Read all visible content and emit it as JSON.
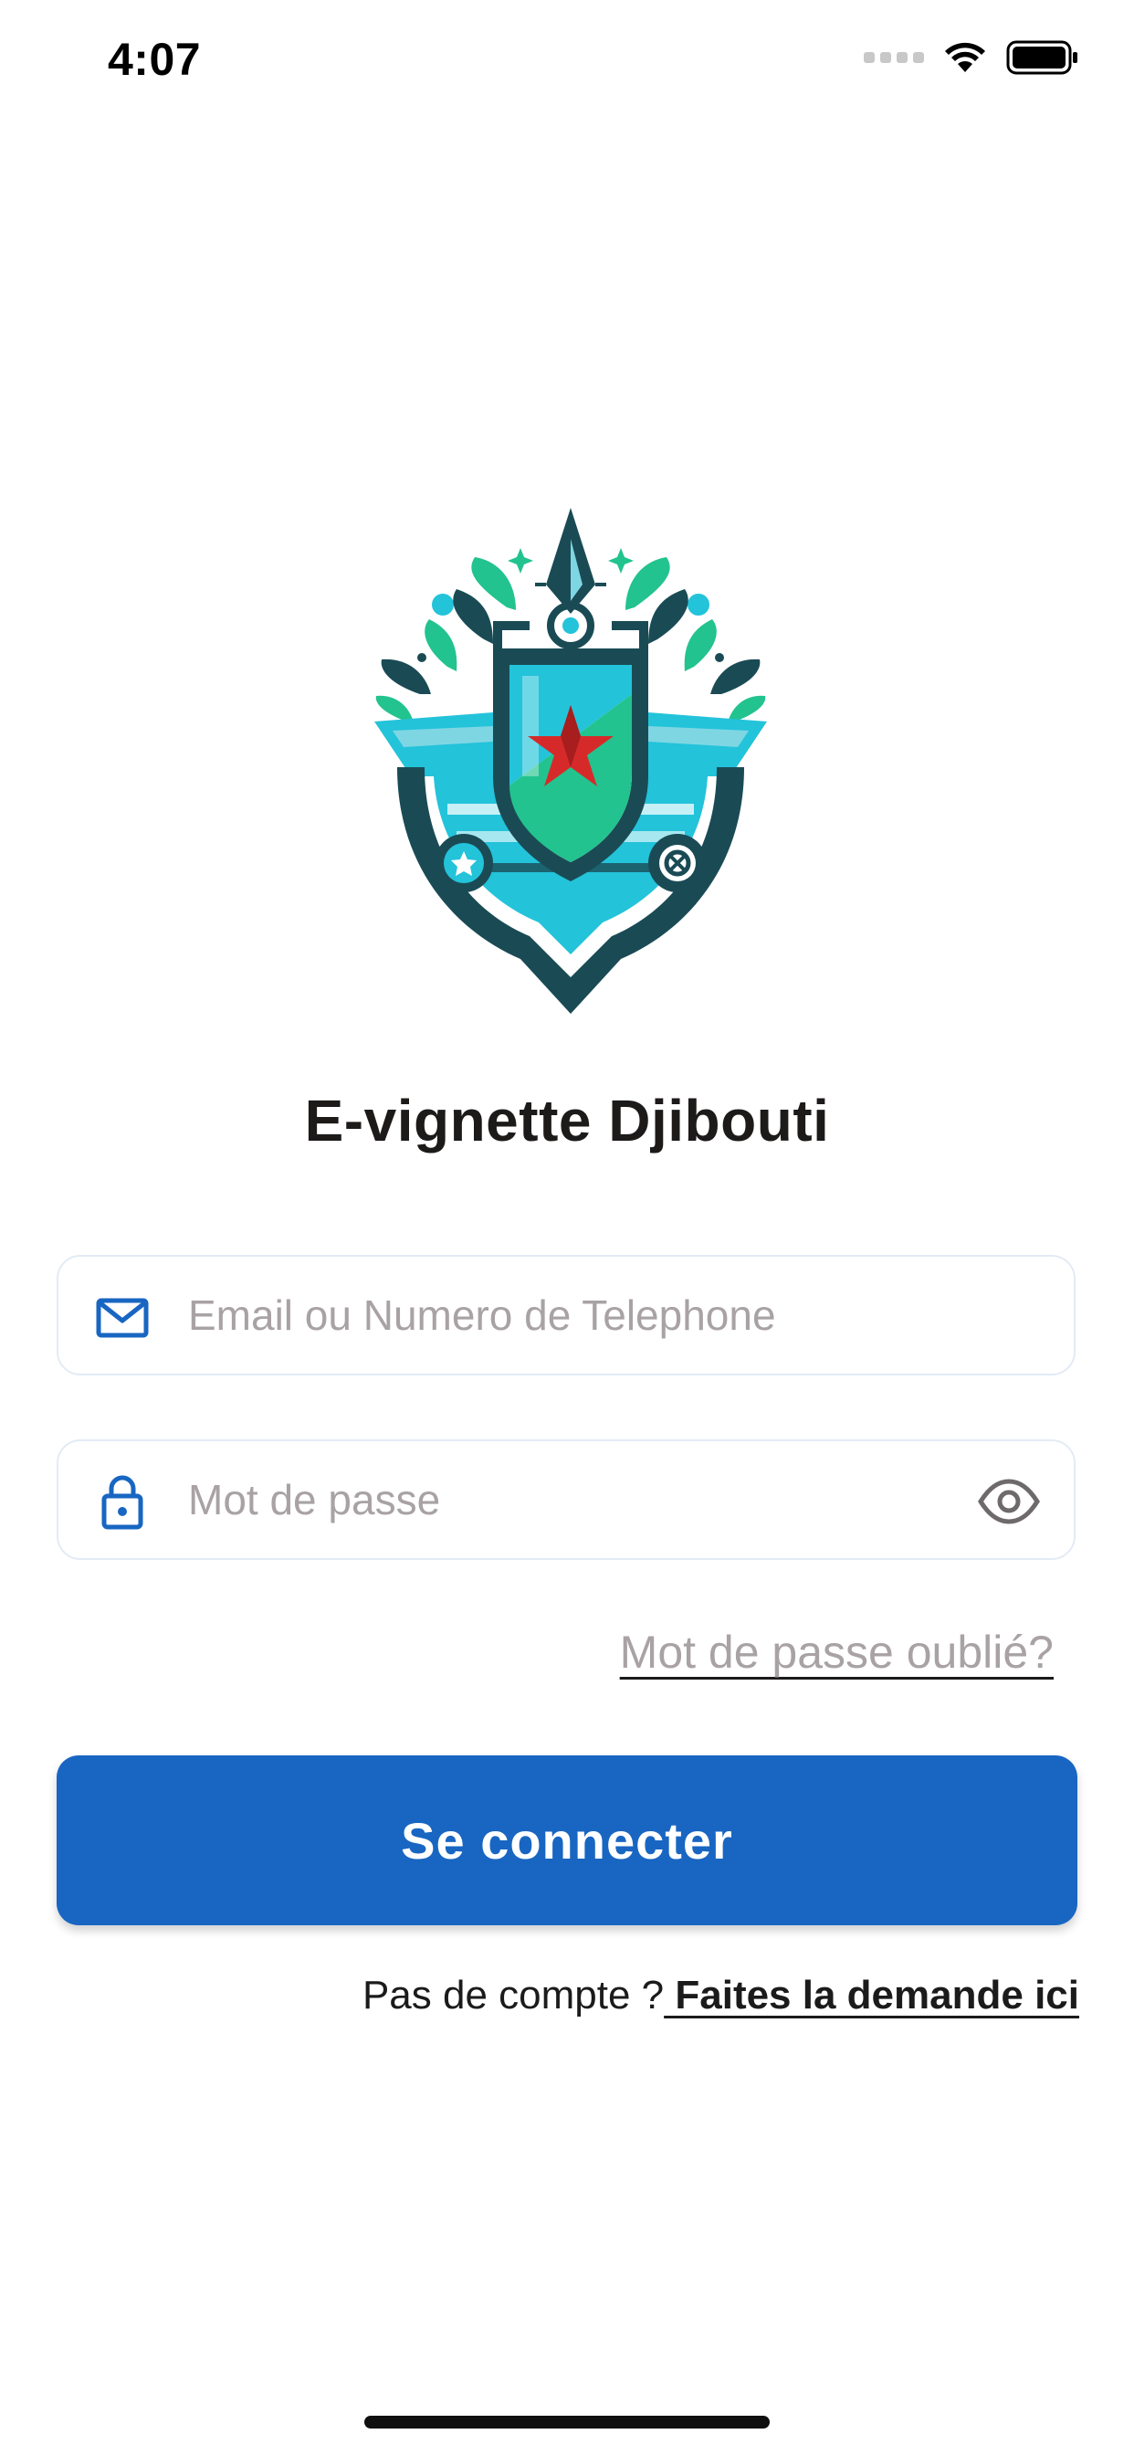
{
  "status_bar": {
    "time": "4:07",
    "icons": [
      "signal-dots-icon",
      "wifi-icon",
      "battery-icon"
    ]
  },
  "app": {
    "title": "E-vignette Djibouti",
    "logo": "emblem-shield-logo"
  },
  "login_form": {
    "email_placeholder": "Email ou Numero de Telephone",
    "email_value": "",
    "password_placeholder": "Mot de passe",
    "password_value": "",
    "forgot_password_label": "Mot de passe oublié?",
    "submit_label": "Se connecter"
  },
  "signup": {
    "prompt": "Pas de compte ?",
    "link_label": " Faites la demande ici"
  },
  "colors": {
    "primary": "#1866c2",
    "title": "#1d1a1a",
    "placeholder": "#a9a2a4",
    "field_border": "#e3ebf5",
    "logo_teal": "#23c3da",
    "logo_green": "#22c38e",
    "logo_dark": "#1a4b55",
    "star_red": "#d62a2a"
  }
}
